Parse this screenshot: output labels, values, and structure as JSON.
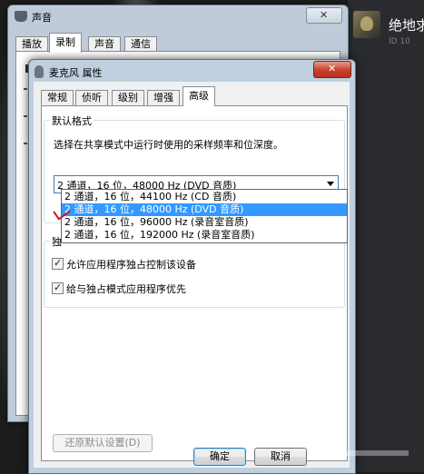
{
  "background_window": {
    "title": "声音",
    "close_label": "✕",
    "tabs": [
      "播放",
      "录制",
      "声音",
      "通信"
    ],
    "active_tab_index": 1
  },
  "game_panel": {
    "title": "绝地求",
    "id_text": "ID 10"
  },
  "properties_window": {
    "title": "麦克风 属性",
    "close_label": "✕",
    "tabs": [
      "常规",
      "侦听",
      "级别",
      "增强",
      "高级"
    ],
    "active_tab_index": 4,
    "default_format": {
      "group_label": "默认格式",
      "description": "选择在共享模式中运行时使用的采样频率和位深度。",
      "selected_value": "2 通道，16 位，48000 Hz (DVD 音质)",
      "options": [
        "2 通道，16 位，44100 Hz (CD 音质)",
        "2 通道，16 位，48000 Hz (DVD 音质)",
        "2 通道，16 位，96000 Hz (录音室音质)",
        "2 通道，16 位，192000 Hz (录音室音质)"
      ],
      "highlighted_option_index": 1
    },
    "exclusive_group_label": "独",
    "checkboxes": [
      {
        "label": "允许应用程序独占控制该设备",
        "checked": true
      },
      {
        "label": "给与独占模式应用程序优先",
        "checked": true
      }
    ],
    "restore_button": "还原默认设置(D)",
    "ok_button": "确定",
    "cancel_button": "取消"
  },
  "colors": {
    "selection": "#3399ff",
    "annotation_mark": "#d01a1a",
    "close_button": "#c7402b"
  }
}
